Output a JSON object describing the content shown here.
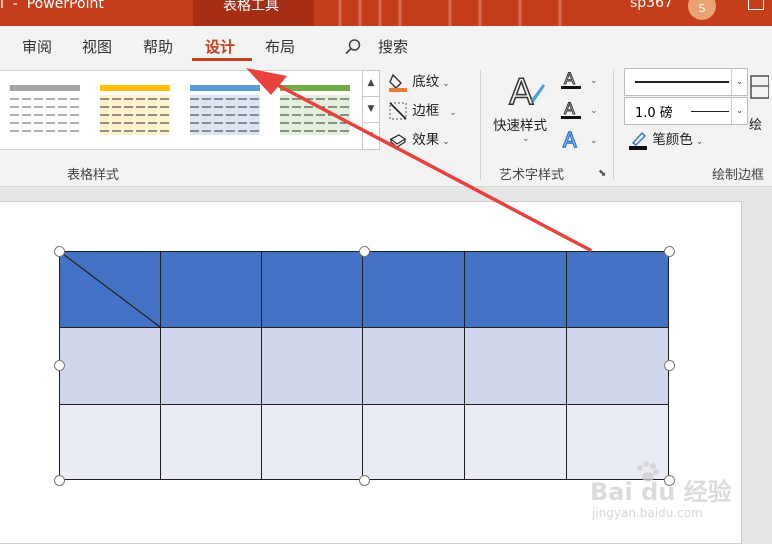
{
  "window": {
    "title": "l  -  PowerPoint",
    "context_tab": "表格工具",
    "user": "sp367",
    "avatar_initial": "S"
  },
  "tabs": [
    {
      "label": "审阅",
      "active": false
    },
    {
      "label": "视图",
      "active": false
    },
    {
      "label": "帮助",
      "active": false
    },
    {
      "label": "设计",
      "active": true
    },
    {
      "label": "布局",
      "active": false
    }
  ],
  "search": {
    "label": "搜索"
  },
  "ribbon": {
    "table_styles": {
      "group_label": "表格样式"
    },
    "shading": {
      "label": "底纹"
    },
    "borders": {
      "label": "边框"
    },
    "effects": {
      "label": "效果"
    },
    "wordart": {
      "quick_styles_label": "快速样式",
      "group_label": "艺术字样式"
    },
    "draw_borders": {
      "weight_value": "1.0 磅",
      "pen_color_label": "笔颜色",
      "draw_table_label": "绘",
      "group_label": "绘制边框"
    }
  },
  "colors": {
    "accent": "#c43e1c",
    "header_fill": "#4472c4",
    "row1_fill": "#cfd5ea",
    "row2_fill": "#e9ebf5",
    "arrow": "#e8423f"
  },
  "watermark": {
    "main": "Bai du 经验",
    "sub": "jingyan.baidu.com"
  }
}
